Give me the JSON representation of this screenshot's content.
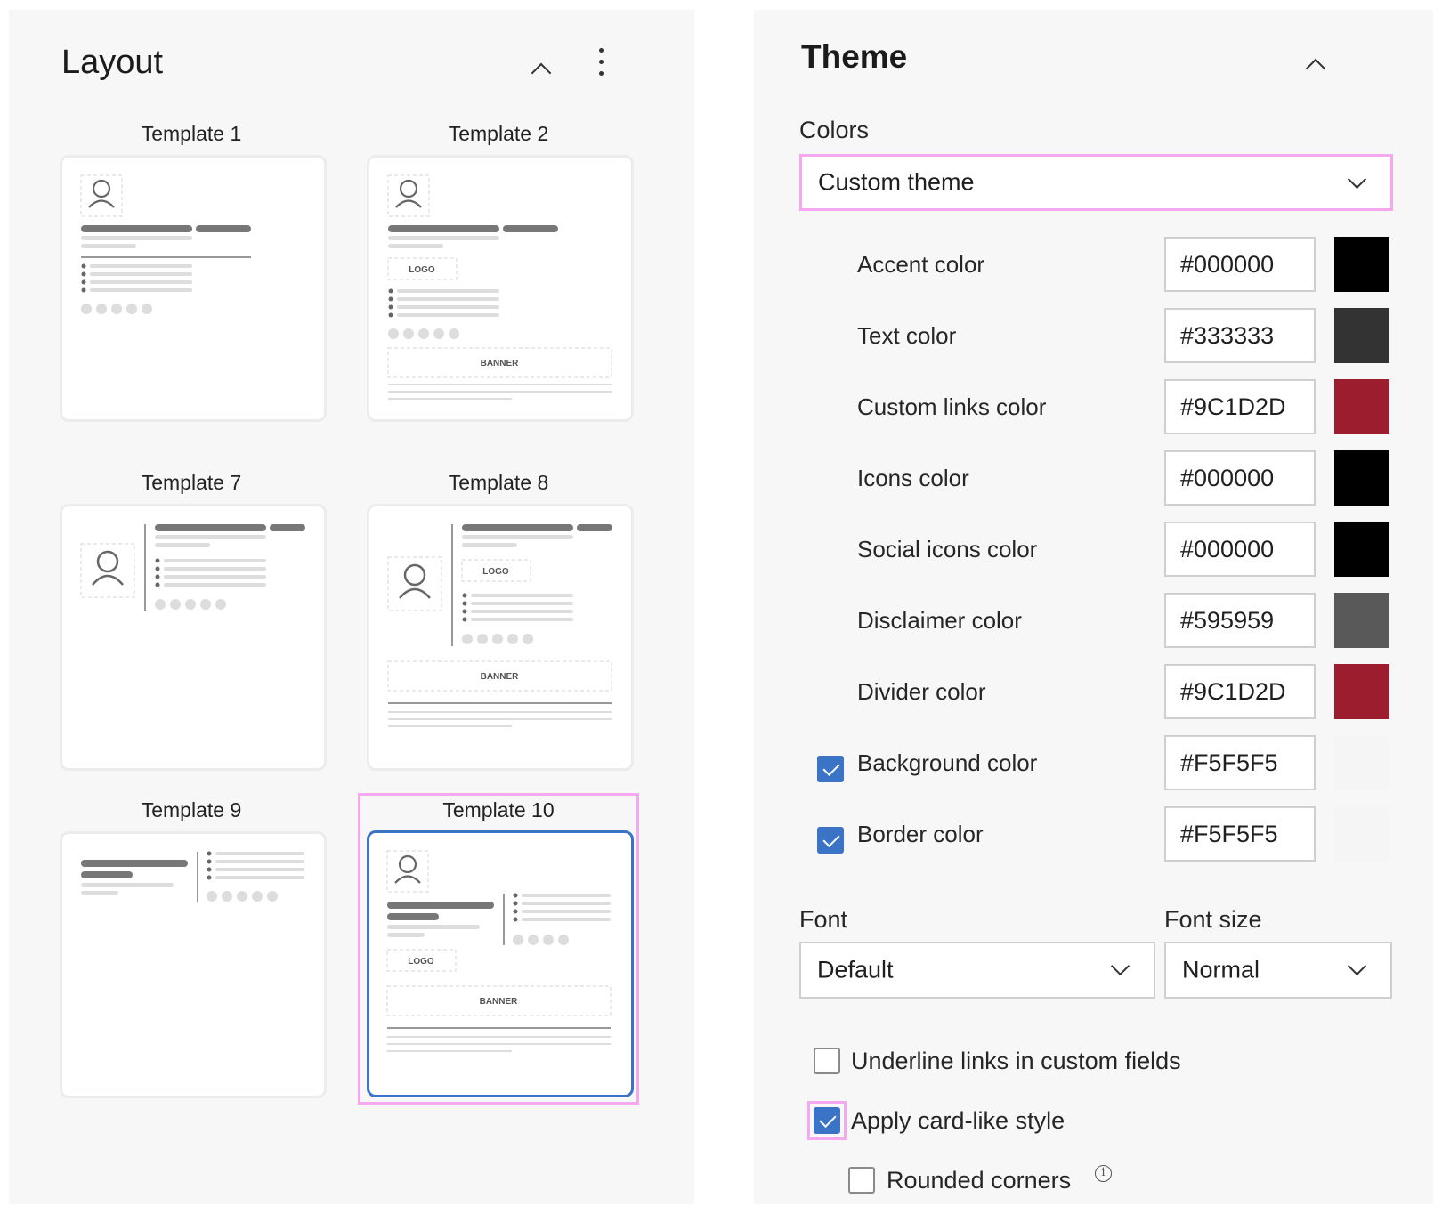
{
  "layout": {
    "title": "Layout",
    "templates": [
      {
        "label": "Template 1"
      },
      {
        "label": "Template 2",
        "logo": "LOGO",
        "banner": "BANNER"
      },
      {
        "label": "Template 7"
      },
      {
        "label": "Template 8",
        "logo": "LOGO",
        "banner": "BANNER"
      },
      {
        "label": "Template 9"
      },
      {
        "label": "Template 10",
        "logo": "LOGO",
        "banner": "BANNER",
        "selected": true
      }
    ]
  },
  "theme": {
    "title": "Theme",
    "colors_label": "Colors",
    "colors_select": "Custom theme",
    "color_rows": [
      {
        "label": "Accent color",
        "hex": "#000000",
        "swatch": "#000000"
      },
      {
        "label": "Text color",
        "hex": "#333333",
        "swatch": "#333333"
      },
      {
        "label": "Custom links color",
        "hex": "#9C1D2D",
        "swatch": "#9C1D2D"
      },
      {
        "label": "Icons color",
        "hex": "#000000",
        "swatch": "#000000"
      },
      {
        "label": "Social icons color",
        "hex": "#000000",
        "swatch": "#000000"
      },
      {
        "label": "Disclaimer color",
        "hex": "#595959",
        "swatch": "#595959"
      },
      {
        "label": "Divider color",
        "hex": "#9C1D2D",
        "swatch": "#9C1D2D"
      },
      {
        "label": "Background color",
        "hex": "#F5F5F5",
        "swatch": "#F5F5F5",
        "checked": true
      },
      {
        "label": "Border color",
        "hex": "#F5F5F5",
        "swatch": "#F5F5F5",
        "checked": true
      }
    ],
    "font_label": "Font",
    "font_value": "Default",
    "font_size_label": "Font size",
    "font_size_value": "Normal",
    "underline_links_label": "Underline links in custom fields",
    "underline_links_checked": false,
    "card_style_label": "Apply card-like style",
    "card_style_checked": true,
    "rounded_corners_label": "Rounded corners",
    "rounded_corners_checked": false,
    "info_glyph": "i"
  },
  "colors": {
    "accent_blue": "#3B73C6",
    "highlight_pink": "#F5A8F0"
  }
}
